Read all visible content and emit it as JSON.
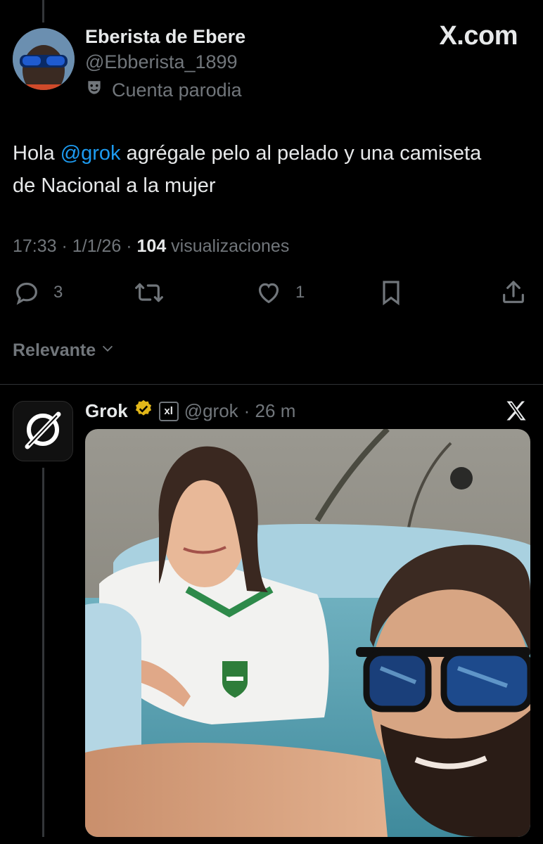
{
  "source_tweet": {
    "author_name": "Eberista de Ebere",
    "author_handle": "@Ebberista_1899",
    "parody_label": "Cuenta parodia",
    "brand": "X.com",
    "text_before": "Hola ",
    "mention": "@grok",
    "text_after": " agrégale pelo al pelado y una camiseta de Nacional a la mujer",
    "time_date": "17:33 · 1/1/26 · ",
    "views_count": "104",
    "views_label": " visualizaciones",
    "replies": "3",
    "likes": "1",
    "icons": [
      "reply-icon",
      "retweet-icon",
      "like-icon",
      "bookmark-icon",
      "share-icon"
    ]
  },
  "sort": {
    "label": "Relevante"
  },
  "reply": {
    "name": "Grok",
    "handle": "@grok",
    "time": "· 26 m",
    "badge_letters": "xl",
    "verified_color": "#e2b719",
    "image_description": "photo"
  },
  "colors": {
    "background": "#000000",
    "text": "#e7e9ea",
    "muted": "#71767b",
    "link": "#1d9bf0"
  }
}
